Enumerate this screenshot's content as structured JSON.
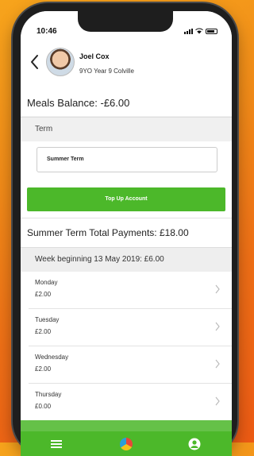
{
  "status_bar": {
    "time": "10:46"
  },
  "header": {
    "student_name": "Joel Cox",
    "student_details": "9YO  Year 9  Colville"
  },
  "meals": {
    "balance": "Meals Balance: -£6.00"
  },
  "term": {
    "label": "Term",
    "selected": "Summer Term"
  },
  "topup": {
    "label": "Top Up Account"
  },
  "summary": {
    "total": "Summer Term Total Payments: £18.00"
  },
  "week": {
    "heading": "Week beginning 13 May 2019: £6.00",
    "days": [
      {
        "name": "Monday",
        "amount": "£2.00"
      },
      {
        "name": "Tuesday",
        "amount": "£2.00"
      },
      {
        "name": "Wednesday",
        "amount": "£2.00"
      },
      {
        "name": "Thursday",
        "amount": "£0.00"
      }
    ]
  },
  "icons": {
    "back": "chevron-left-icon",
    "menu": "menu-icon",
    "home": "home-logo-icon",
    "account": "account-icon"
  },
  "colors": {
    "accent": "#4cb82a",
    "background": "#f08a18"
  }
}
